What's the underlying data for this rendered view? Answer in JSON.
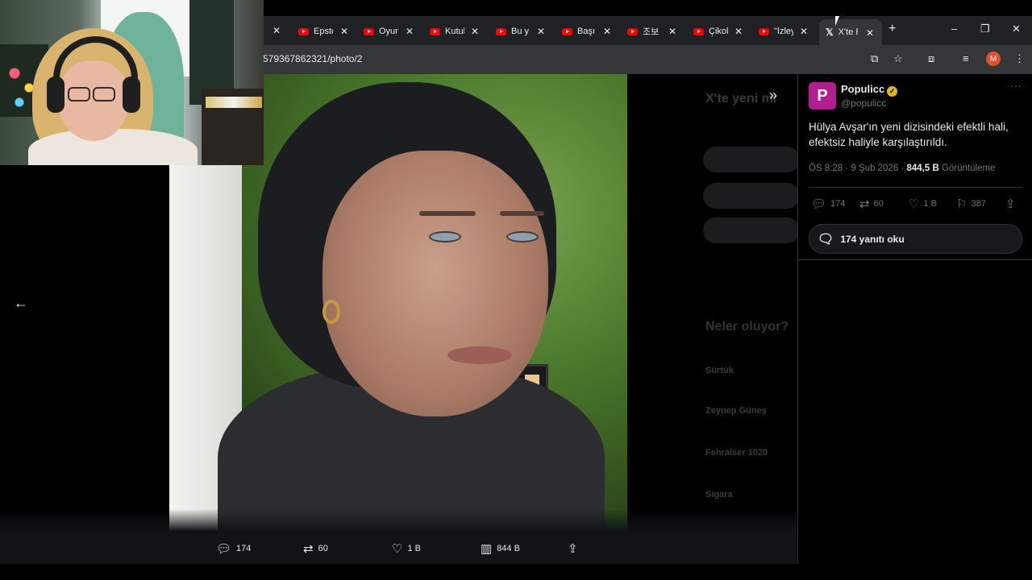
{
  "browser": {
    "tabs": [
      {
        "label": "Epste"
      },
      {
        "label": "Oyun"
      },
      {
        "label": "Kutul"
      },
      {
        "label": "Bu y"
      },
      {
        "label": "Başı"
      },
      {
        "label": "조보"
      },
      {
        "label": "Çikol"
      },
      {
        "label": "\"İzley"
      },
      {
        "label": "X'te P"
      }
    ],
    "url": "579367862321/photo/2",
    "profile_initial": "M",
    "icons": {
      "new_tab": "+",
      "minimize": "–",
      "restore": "❐",
      "close": "✕",
      "cast": "⧉",
      "bookmark": "☆",
      "extensions": "⧈",
      "media": "≡",
      "menu": "⋮"
    }
  },
  "tweet": {
    "display_name": "Populicc",
    "handle": "@populicc",
    "avatar_letter": "P",
    "text": "Hülya Avşar'ın yeni dizisindeki efektli hali, efektsiz haliyle karşılaştırıldı.",
    "time_date": "ÖS 8:28 · 9 Şub 2026 · ",
    "views_count": "844,5 B",
    "views_label": " Görüntüleme",
    "replies": "174",
    "retweets": "60",
    "likes": "1 B",
    "bookmarks": "387",
    "read_replies": "174 yanıtı oku"
  },
  "photo_bar": {
    "replies": "174",
    "retweets": "60",
    "likes": "1 B",
    "views": "844 B"
  },
  "background_panel": {
    "title": "X'te yeni mi",
    "section": "Neler oluyor?",
    "items": [
      "Sürtük",
      "Zeynep Güneş",
      "Fehraiser 1020",
      "Sigara"
    ]
  },
  "colors": {
    "accent": "#1d9bf0",
    "avatar_bg": "#b01e8f",
    "verified": "#e2b719",
    "profile": "#e2502f"
  }
}
